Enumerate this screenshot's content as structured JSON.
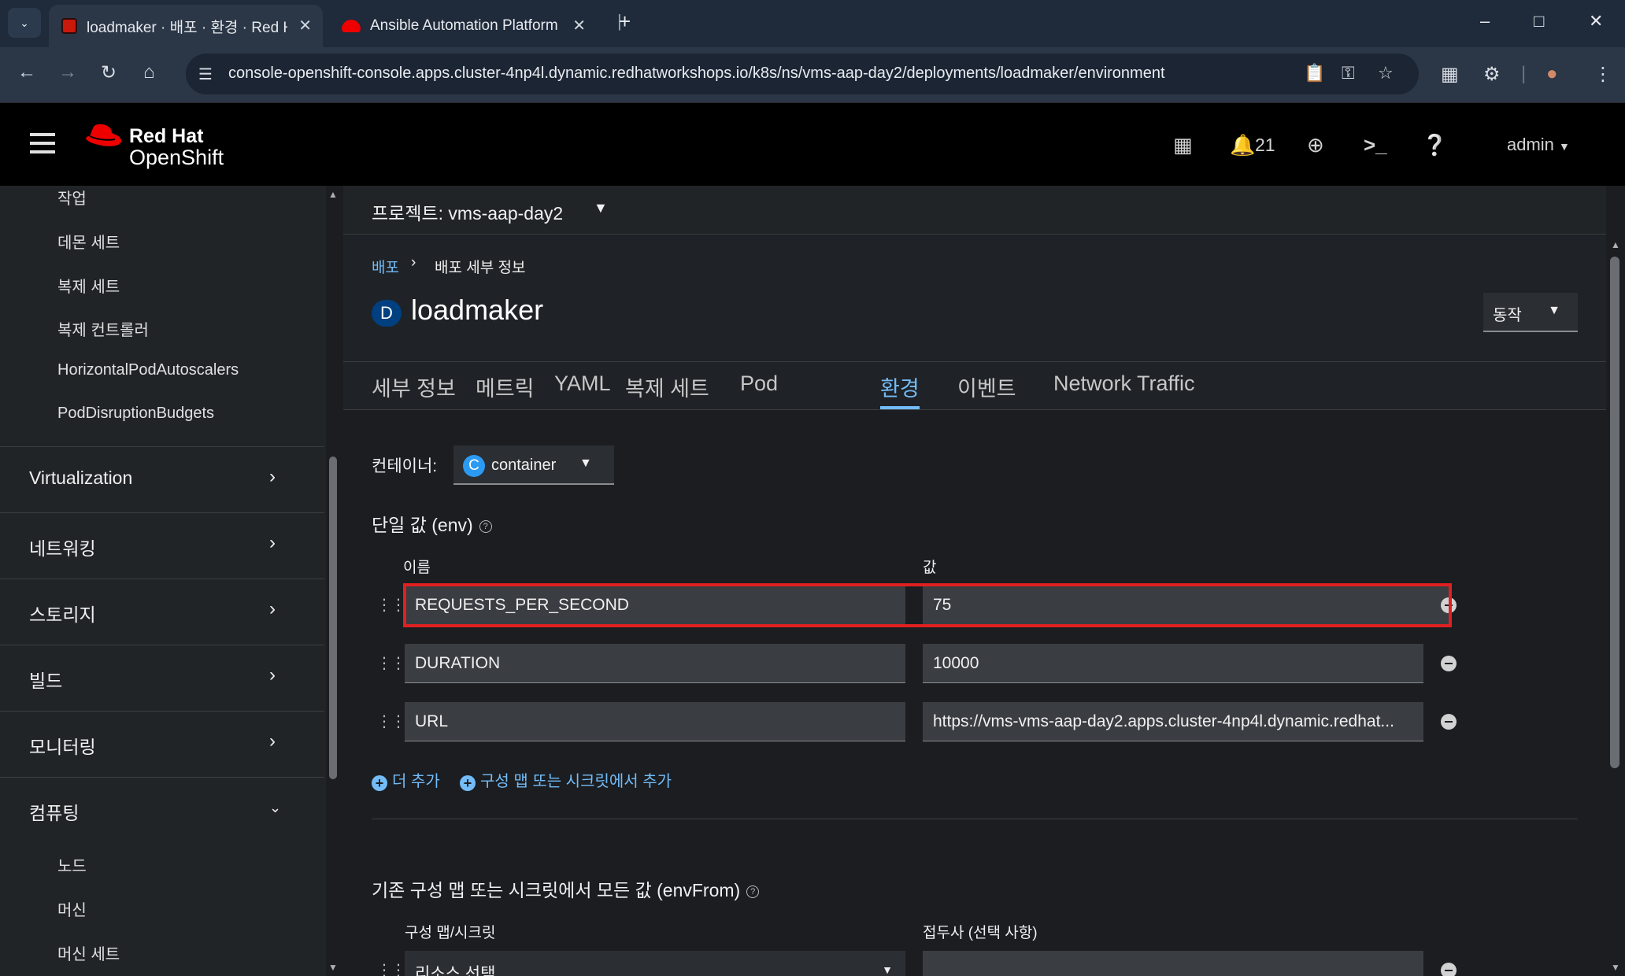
{
  "browser": {
    "tabs": [
      {
        "title": "loadmaker · 배포 · 환경 · Red Hat",
        "active": true
      },
      {
        "title": "Ansible Automation Platform",
        "active": false
      }
    ],
    "url": "console-openshift-console.apps.cluster-4np4l.dynamic.redhatworkshops.io/k8s/ns/vms-aap-day2/deployments/loadmaker/environment"
  },
  "masthead": {
    "brand_line1": "Red Hat",
    "brand_line2": "OpenShift",
    "notifications_count": "21",
    "user": "admin"
  },
  "sidebar": {
    "top_items": [
      "작업",
      "데몬 세트",
      "복제 세트",
      "복제 컨트롤러",
      "HorizontalPodAutoscalers",
      "PodDisruptionBudgets"
    ],
    "sections": [
      {
        "label": "Virtualization",
        "expanded": false
      },
      {
        "label": "네트워킹",
        "expanded": false
      },
      {
        "label": "스토리지",
        "expanded": false
      },
      {
        "label": "빌드",
        "expanded": false
      },
      {
        "label": "모니터링",
        "expanded": false
      },
      {
        "label": "컴퓨팅",
        "expanded": true
      }
    ],
    "compute_items": [
      "노드",
      "머신",
      "머신 세트"
    ]
  },
  "project": {
    "label": "프로젝트: vms-aap-day2"
  },
  "breadcrumb": {
    "parent": "배포",
    "current": "배포 세부 정보"
  },
  "resource": {
    "badge": "D",
    "name": "loadmaker"
  },
  "actions_label": "동작",
  "tabs": [
    "세부 정보",
    "메트릭",
    "YAML",
    "복제 세트",
    "Pod",
    "환경",
    "이벤트",
    "Network Traffic"
  ],
  "active_tab": "환경",
  "container": {
    "label": "컨테이너:",
    "badge": "C",
    "value": "container"
  },
  "env": {
    "title": "단일 값 (env)",
    "name_header": "이름",
    "value_header": "값",
    "rows": [
      {
        "name": "REQUESTS_PER_SECOND",
        "value": "75"
      },
      {
        "name": "DURATION",
        "value": "10000"
      },
      {
        "name": "URL",
        "value": "https://vms-vms-aap-day2.apps.cluster-4np4l.dynamic.redhat..."
      }
    ],
    "add_more": "더 추가",
    "add_from": "구성 맵 또는 시크릿에서 추가"
  },
  "envfrom": {
    "title": "기존 구성 맵 또는 시크릿에서 모든 값 (envFrom)",
    "source_header": "구성 맵/시크릿",
    "prefix_header": "접두사 (선택 사항)",
    "source_placeholder": "리소스 선택"
  }
}
